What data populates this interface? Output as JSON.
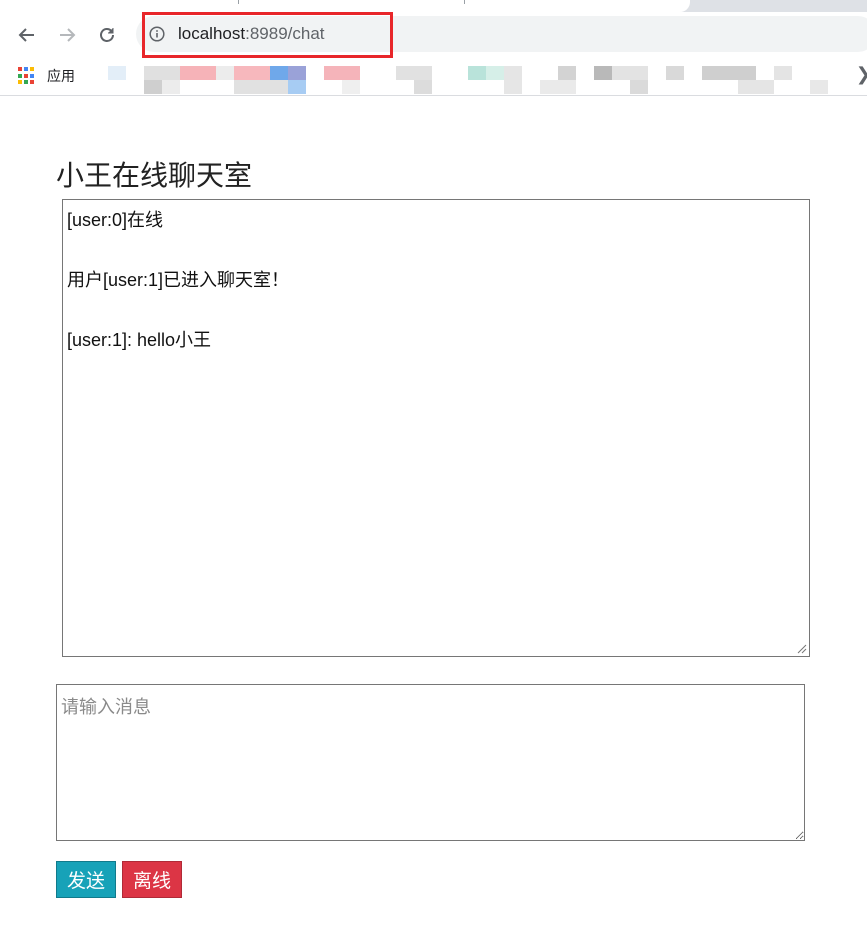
{
  "browser": {
    "url_host": "localhost",
    "url_rest": ":8989/chat",
    "bookmarks_apps_label": "应用",
    "colors": {
      "highlight": "#e8262a"
    }
  },
  "page": {
    "title": "小王在线聊天室"
  },
  "chat_log": {
    "lines": [
      "[user:0]在线",
      "用户[user:1]已进入聊天室！",
      "[user:1]: hello小王"
    ]
  },
  "composer": {
    "placeholder": "请输入消息",
    "value": ""
  },
  "buttons": {
    "send": "发送",
    "leave": "离线",
    "colors": {
      "send": "#17a2b8",
      "leave": "#dc3545"
    }
  }
}
